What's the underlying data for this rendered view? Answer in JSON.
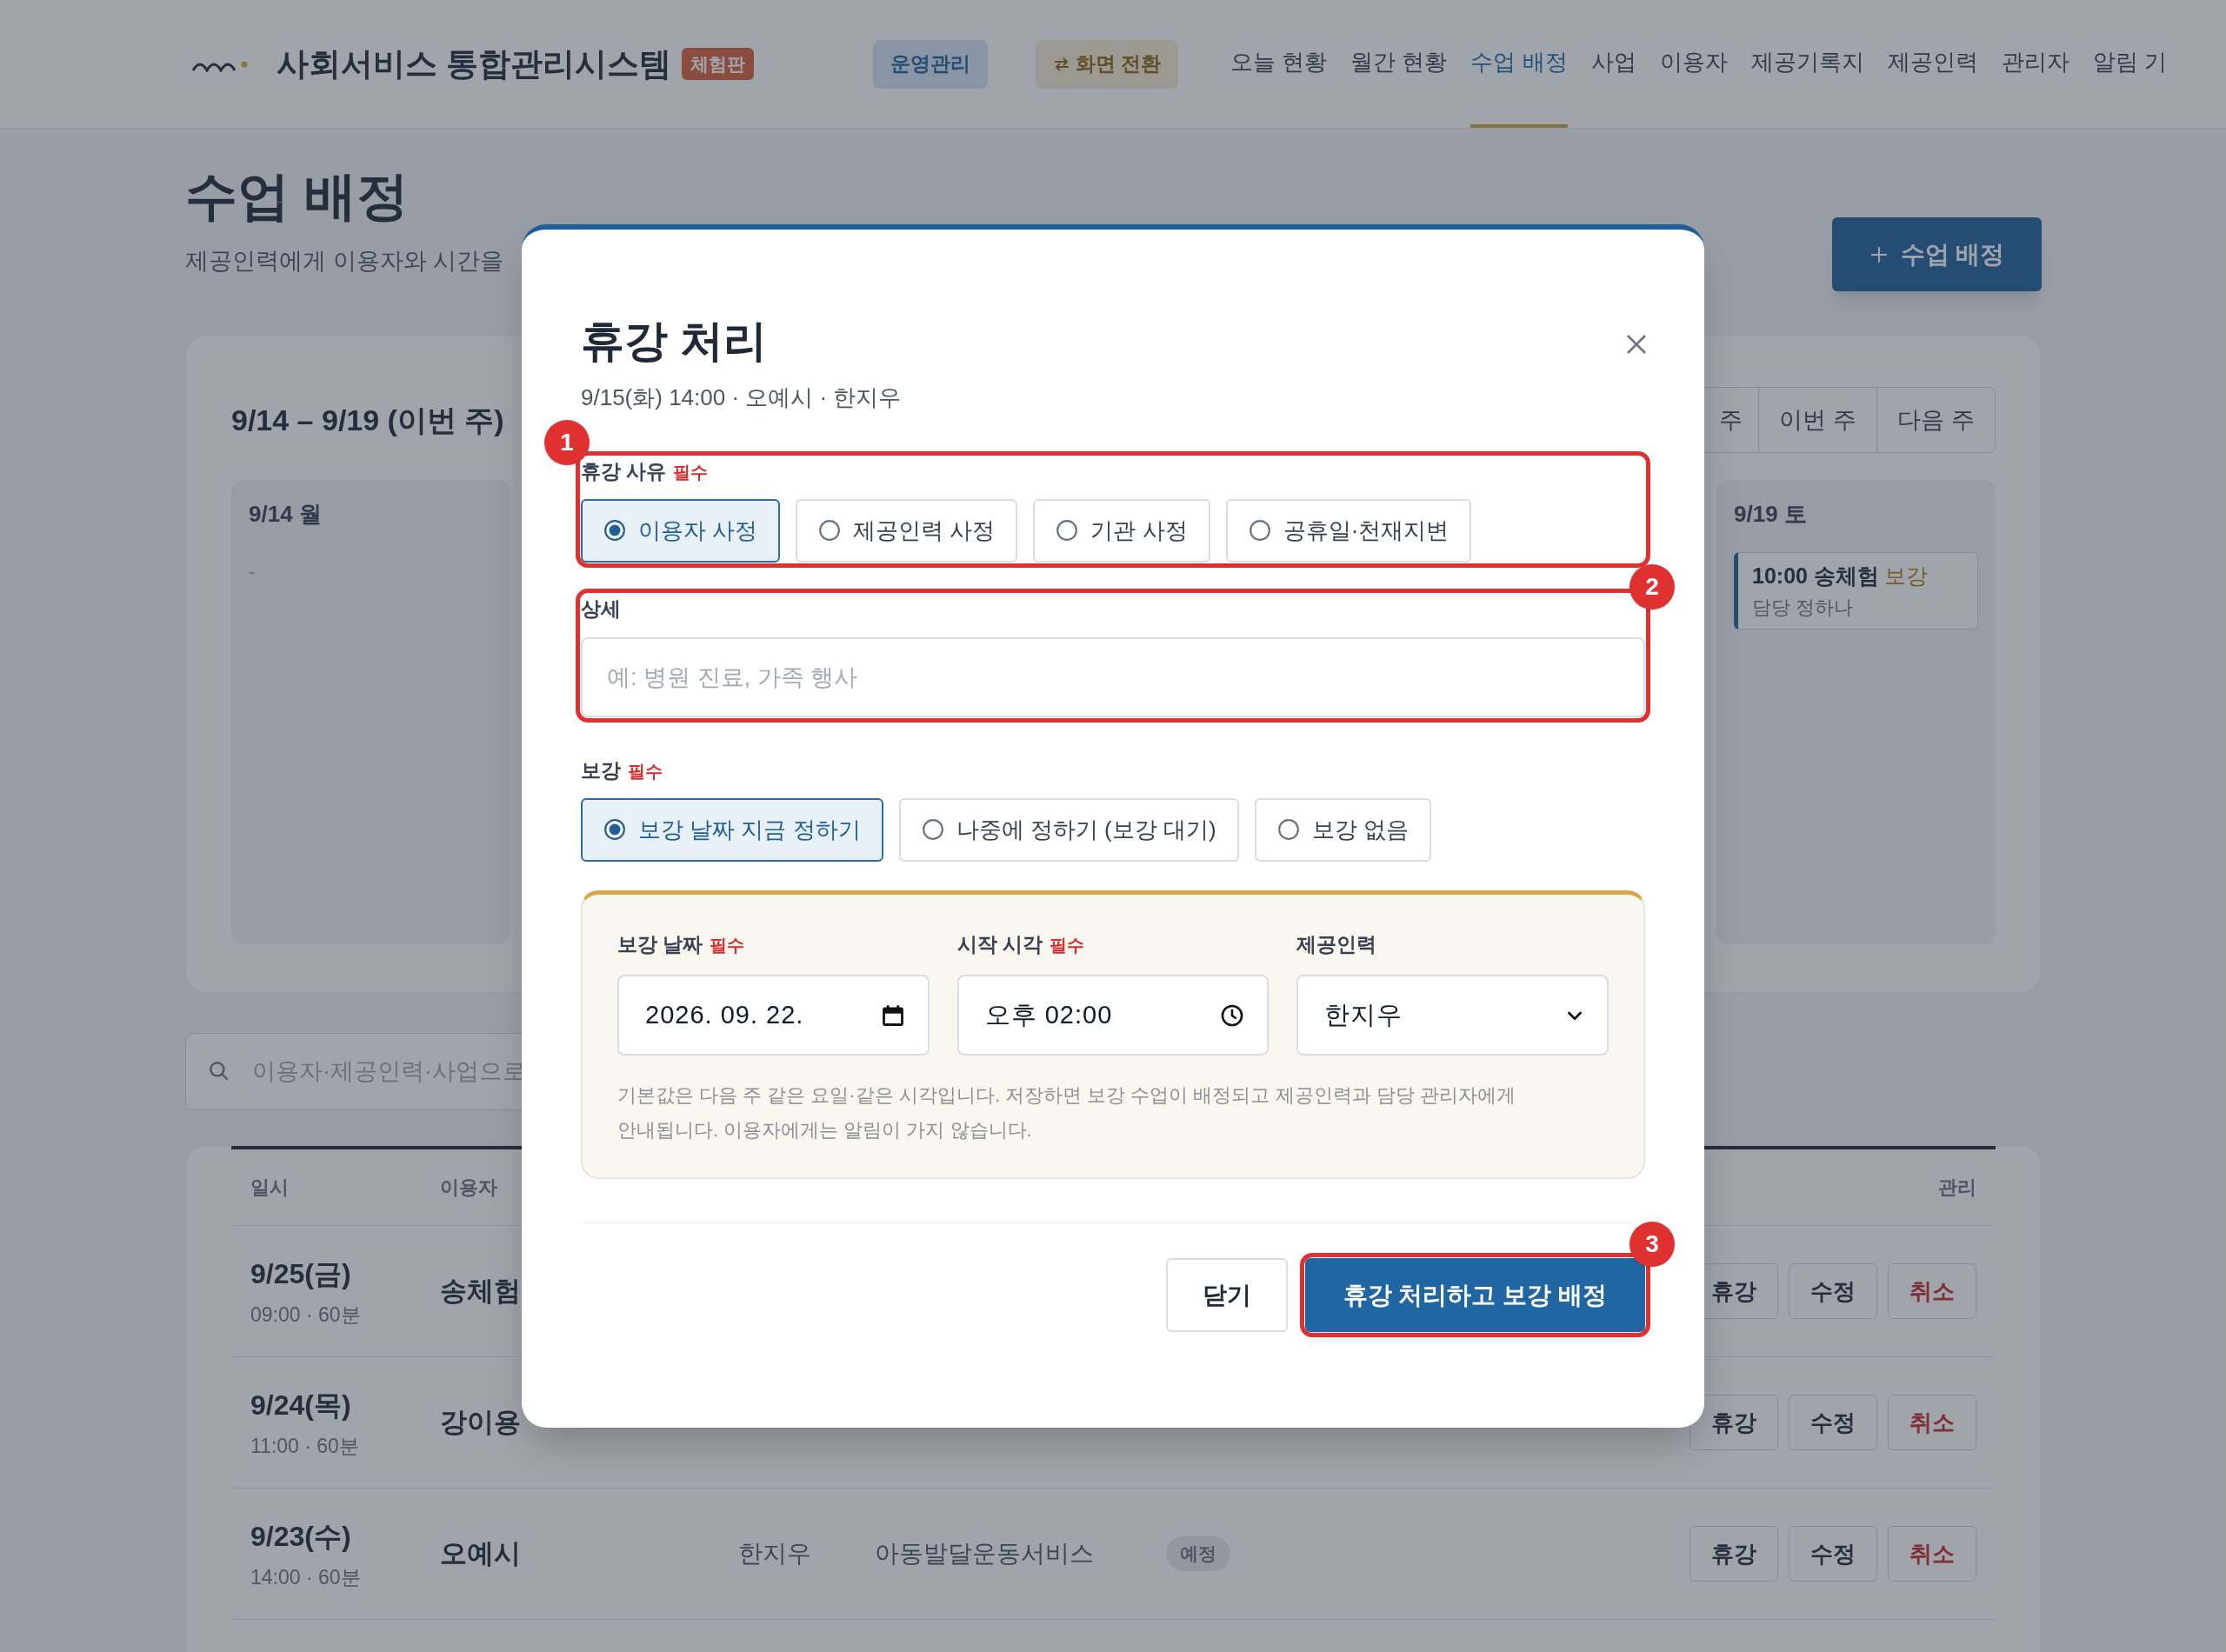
{
  "header": {
    "title": "사회서비스 통합관리시스템",
    "badge": "체험판",
    "mode_button": "운영관리",
    "switch_button": "화면 전환",
    "nav": [
      {
        "label": "오늘 현황",
        "selected": false
      },
      {
        "label": "월간 현황",
        "selected": false
      },
      {
        "label": "수업 배정",
        "selected": true
      },
      {
        "label": "사업",
        "selected": false
      },
      {
        "label": "이용자",
        "selected": false
      },
      {
        "label": "제공기록지",
        "selected": false
      },
      {
        "label": "제공인력",
        "selected": false
      },
      {
        "label": "관리자",
        "selected": false
      },
      {
        "label": "알림 기",
        "selected": false
      }
    ]
  },
  "page": {
    "title": "수업 배정",
    "subtitle": "제공인력에게 이용자와 시간을",
    "add_button": "수업 배정"
  },
  "week": {
    "title": "9/14 – 9/19 (이번 주)",
    "nav": [
      {
        "label": "주",
        "selected": false
      },
      {
        "label": "이번 주",
        "selected": false
      },
      {
        "label": "다음 주",
        "selected": false
      }
    ],
    "days": [
      {
        "label": "9/14 월",
        "empty_text": "-"
      },
      {
        "label": "9/19 토",
        "events": [
          {
            "time_user": "10:00 송체험",
            "tag": "보강",
            "staff": "담당 정하나"
          }
        ]
      }
    ]
  },
  "search": {
    "placeholder": "이용자·제공인력·사업으로"
  },
  "table": {
    "columns": [
      "일시",
      "이용자",
      "관리"
    ],
    "rows": [
      {
        "date": "9/25(금)",
        "time": "09:00 · 60분",
        "user": "송체험",
        "actions": [
          "휴강",
          "수정",
          "취소"
        ]
      },
      {
        "date": "9/24(목)",
        "time": "11:00 · 60분",
        "user": "강이용",
        "actions": [
          "휴강",
          "수정",
          "취소"
        ]
      },
      {
        "date": "9/23(수)",
        "time": "14:00 · 60분",
        "user": "오예시",
        "provider": "한지우",
        "service": "아동발달운동서비스",
        "status": "예정",
        "actions": [
          "휴강",
          "수정",
          "취소"
        ]
      }
    ]
  },
  "dialog": {
    "title": "휴강 처리",
    "subtitle": "9/15(화) 14:00 · 오예시 · 한지우",
    "reason": {
      "label": "휴강 사유",
      "required": "필수",
      "annotation": "1",
      "options": [
        {
          "label": "이용자 사정",
          "selected": true
        },
        {
          "label": "제공인력 사정",
          "selected": false
        },
        {
          "label": "기관 사정",
          "selected": false
        },
        {
          "label": "공휴일·천재지변",
          "selected": false
        }
      ]
    },
    "detail": {
      "label": "상세",
      "placeholder": "예: 병원 진료, 가족 행사",
      "annotation": "2"
    },
    "makeup": {
      "label": "보강",
      "required": "필수",
      "options": [
        {
          "label": "보강 날짜 지금 정하기",
          "selected": true
        },
        {
          "label": "나중에 정하기 (보강 대기)",
          "selected": false
        },
        {
          "label": "보강 없음",
          "selected": false
        }
      ]
    },
    "panel": {
      "fields": [
        {
          "kind": "date",
          "label": "보강 날짜",
          "required": "필수",
          "value": "2026. 09. 22."
        },
        {
          "kind": "time",
          "label": "시작 시각",
          "required": "필수",
          "value": "오후 02:00"
        },
        {
          "kind": "select",
          "label": "제공인력",
          "value": "한지우"
        }
      ],
      "help": "기본값은 다음 주 같은 요일·같은 시각입니다. 저장하면 보강 수업이 배정되고 제공인력과 담당 관리자에게 안내됩니다. 이용자에게는 알림이 가지 않습니다."
    },
    "buttons": [
      {
        "kind": "secondary",
        "label": "닫기"
      },
      {
        "kind": "primary",
        "label": "휴강 처리하고 보강 배정",
        "annotation": "3"
      }
    ]
  }
}
